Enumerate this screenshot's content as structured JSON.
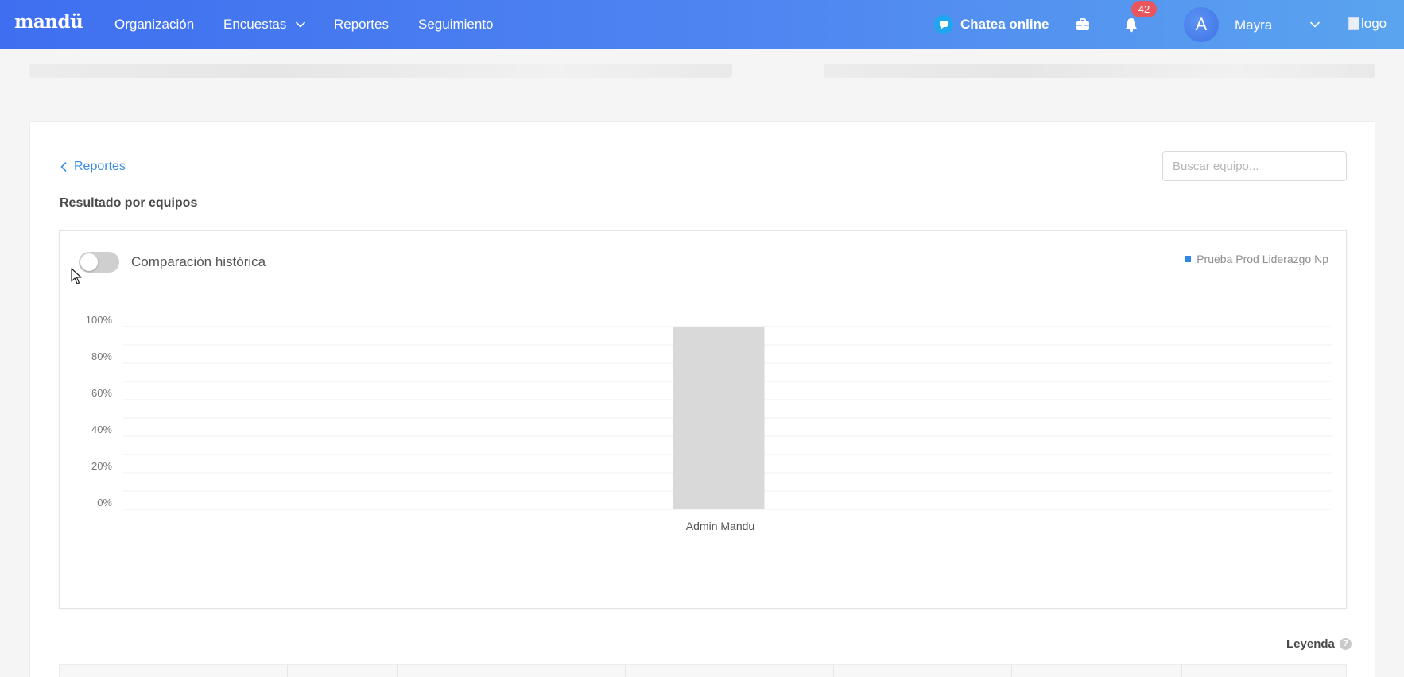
{
  "navbar": {
    "brand": "mandü",
    "items": [
      {
        "label": "Organización"
      },
      {
        "label": "Encuestas"
      },
      {
        "label": "Reportes"
      },
      {
        "label": "Seguimiento"
      }
    ],
    "chat_label": "Chatea online",
    "notifications_count": "42",
    "avatar_letter": "A",
    "user_name": "Mayra",
    "logo_alt": "logo",
    "icons": {
      "chat": "chat-bubble-icon",
      "tools": "briefcase-icon",
      "notifications": "bell-icon",
      "user_menu": "chevron-down-icon"
    },
    "colors": {
      "gradient_start": "#3f6ff0",
      "gradient_end": "#5aa4ef",
      "badge": "#e8555d"
    }
  },
  "page": {
    "back_label": "Reportes",
    "section_title": "Resultado por equipos",
    "search": {
      "placeholder": "Buscar equipo...",
      "value": ""
    }
  },
  "chart_panel": {
    "toggle_label": "Comparación histórica",
    "toggle_on": false,
    "legend": [
      {
        "label": "Prueba Prod Liderazgo Np",
        "color": "#2f86e5"
      }
    ]
  },
  "chart_data": {
    "type": "bar",
    "categories": [
      "Admin Mandu"
    ],
    "series": [
      {
        "name": "Prueba Prod Liderazgo Np",
        "values": [
          100
        ],
        "color": "#d9d9d9"
      }
    ],
    "yticks": [
      "0%",
      "20%",
      "40%",
      "60%",
      "80%",
      "100%"
    ],
    "ylim": [
      0,
      100
    ],
    "grid": true,
    "legend_position": "top-right"
  },
  "footer": {
    "legend_label": "Leyenda",
    "help_glyph": "?"
  }
}
